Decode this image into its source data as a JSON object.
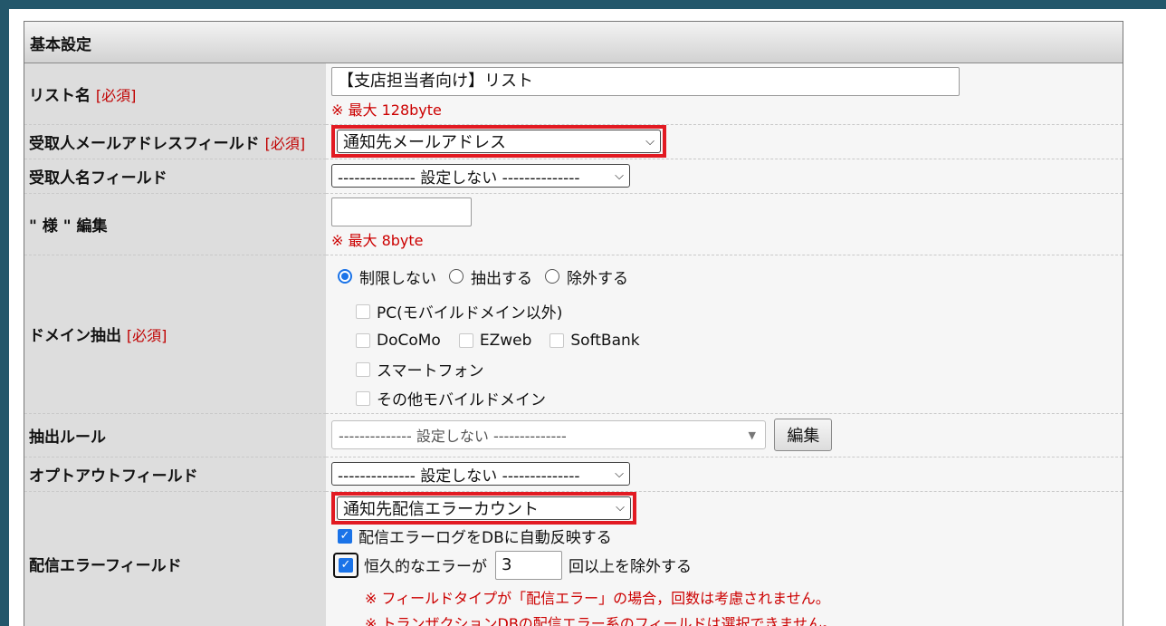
{
  "section": {
    "title": "基本設定"
  },
  "required_mark": "[必須]",
  "list_name": {
    "label": "リスト名",
    "value": "【支店担当者向け】リスト",
    "note": "※ 最大 128byte"
  },
  "recipient_email": {
    "label": "受取人メールアドレスフィールド",
    "selected": "通知先メールアドレス"
  },
  "recipient_name": {
    "label": "受取人名フィールド",
    "selected": "-------------- 設定しない --------------"
  },
  "honorific": {
    "label": "\" 様 \" 編集",
    "value": "",
    "note": "※ 最大 8byte"
  },
  "domain_extract": {
    "label": "ドメイン抽出",
    "radios": [
      "制限しない",
      "抽出する",
      "除外する"
    ],
    "selected_radio": "制限しない",
    "checkboxes": {
      "pc": "PC(モバイルドメイン以外)",
      "docomo": "DoCoMo",
      "ezweb": "EZweb",
      "softbank": "SoftBank",
      "smartphone": "スマートフォン",
      "other_mobile": "その他モバイルドメイン"
    }
  },
  "extract_rule": {
    "label": "抽出ルール",
    "selected": "-------------- 設定しない --------------",
    "edit_button": "編集"
  },
  "optout": {
    "label": "オプトアウトフィールド",
    "selected": "-------------- 設定しない --------------"
  },
  "delivery_error": {
    "label": "配信エラーフィールド",
    "selected": "通知先配信エラーカウント",
    "auto_reflect_label": "配信エラーログをDBに自動反映する",
    "auto_reflect_checked": true,
    "permanent_prefix": "恒久的なエラーが",
    "permanent_count": "3",
    "permanent_suffix": "回以上を除外する",
    "permanent_checked": true,
    "note1": "※ フィールドタイプが「配信エラー」の場合，回数は考慮されません。",
    "note2": "※ トランザクションDBの配信エラー系のフィールドは選択できません。"
  },
  "icons": {
    "dropdown": "chevron-down-icon",
    "combo": "triangle-down-icon",
    "check": "check-icon"
  },
  "colors": {
    "highlight": "#e21a22",
    "required": "#c00000",
    "accent": "#1a73e8",
    "background": "#23576b"
  }
}
